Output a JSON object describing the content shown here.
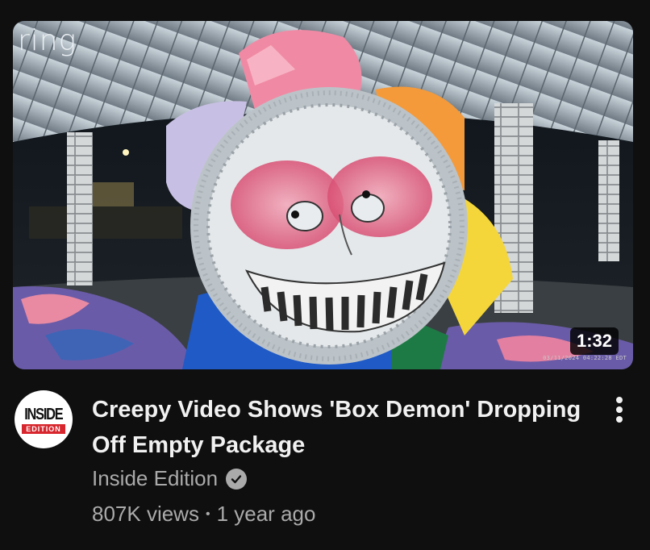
{
  "video": {
    "watermark": "ring",
    "duration": "1:32",
    "camera_timestamp": "03/11/2024 04:22:28 EDT",
    "title": "Creepy Video Shows 'Box Demon' Dropping Off Empty Package"
  },
  "channel": {
    "avatar_line1": "INSIDE",
    "avatar_line2": "EDITION",
    "name": "Inside Edition",
    "verified_icon": "verified-check-icon"
  },
  "stats": {
    "views": "807K views",
    "separator": "•",
    "age": "1 year ago"
  },
  "actions": {
    "menu_icon": "more-vert-icon"
  }
}
